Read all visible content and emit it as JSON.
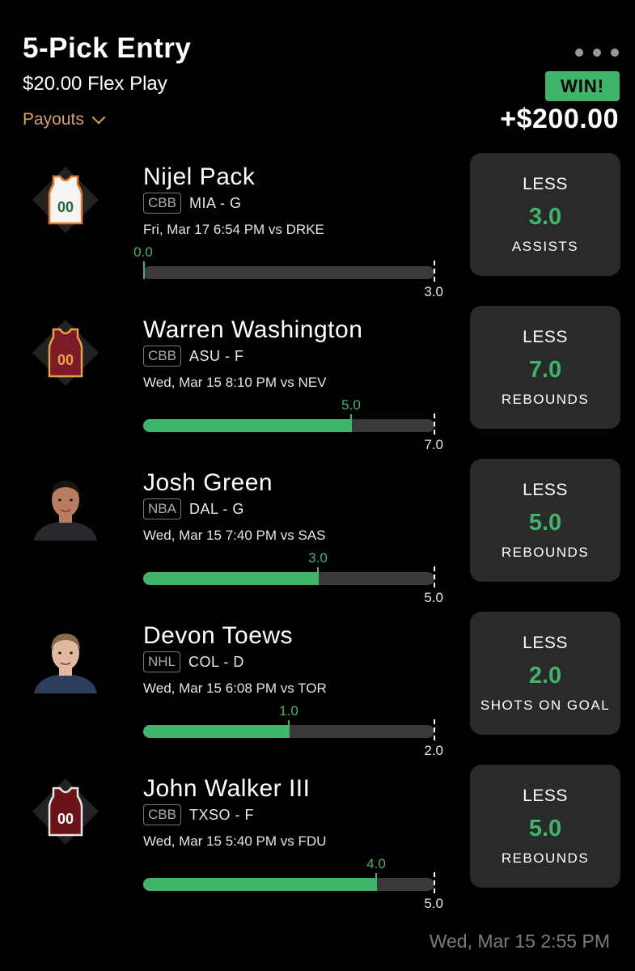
{
  "header": {
    "title": "5-Pick Entry",
    "subtitle": "$20.00 Flex Play",
    "payouts_label": "Payouts",
    "result_badge": "WIN!",
    "result_amount": "+$200.00"
  },
  "picks": [
    {
      "name": "Nijel Pack",
      "league": "CBB",
      "team_pos": "MIA - G",
      "game": "Fri, Mar 17 6:54 PM  vs DRKE",
      "actual": 0.0,
      "actual_label": "0.0",
      "target": 3.0,
      "target_label": "3.0",
      "direction": "LESS",
      "line": "3.0",
      "stat": "ASSISTS",
      "avatar": "jersey",
      "jersey_color": "#f4f4f4",
      "trim_color": "#e07a2a",
      "number_color": "#1f6b3a",
      "number": "00"
    },
    {
      "name": "Warren Washington",
      "league": "CBB",
      "team_pos": "ASU - F",
      "game": "Wed, Mar 15 8:10 PM  vs NEV",
      "actual": 5.0,
      "actual_label": "5.0",
      "target": 7.0,
      "target_label": "7.0",
      "direction": "LESS",
      "line": "7.0",
      "stat": "REBOUNDS",
      "avatar": "jersey",
      "jersey_color": "#7a1a2a",
      "trim_color": "#e8a33b",
      "number_color": "#e8a33b",
      "number": "00"
    },
    {
      "name": "Josh Green",
      "league": "NBA",
      "team_pos": "DAL - G",
      "game": "Wed, Mar 15 7:40 PM  vs SAS",
      "actual": 3.0,
      "actual_label": "3.0",
      "target": 5.0,
      "target_label": "5.0",
      "direction": "LESS",
      "line": "5.0",
      "stat": "REBOUNDS",
      "avatar": "headshot",
      "skin_color": "#b77d5e",
      "hair_color": "#1b1410",
      "shirt_color": "#26282e"
    },
    {
      "name": "Devon Toews",
      "league": "NHL",
      "team_pos": "COL - D",
      "game": "Wed, Mar 15 6:08 PM  vs TOR",
      "actual": 1.0,
      "actual_label": "1.0",
      "target": 2.0,
      "target_label": "2.0",
      "direction": "LESS",
      "line": "2.0",
      "stat": "SHOTS ON GOAL",
      "avatar": "headshot",
      "skin_color": "#e2b9a0",
      "hair_color": "#8a6a4a",
      "shirt_color": "#2c3e5e"
    },
    {
      "name": "John Walker III",
      "league": "CBB",
      "team_pos": "TXSO - F",
      "game": "Wed, Mar 15 5:40 PM  vs FDU",
      "actual": 4.0,
      "actual_label": "4.0",
      "target": 5.0,
      "target_label": "5.0",
      "direction": "LESS",
      "line": "5.0",
      "stat": "REBOUNDS",
      "avatar": "jersey",
      "jersey_color": "#6a1418",
      "trim_color": "#e6e6e6",
      "number_color": "#ffffff",
      "number": "00"
    }
  ],
  "footer": {
    "timestamp": "Wed, Mar 15 2:55 PM"
  },
  "colors": {
    "accent_green": "#3eb56b",
    "payouts_orange": "#d9a15a",
    "card_bg": "#2a2a2a",
    "muted_text": "#7c7c7c"
  }
}
